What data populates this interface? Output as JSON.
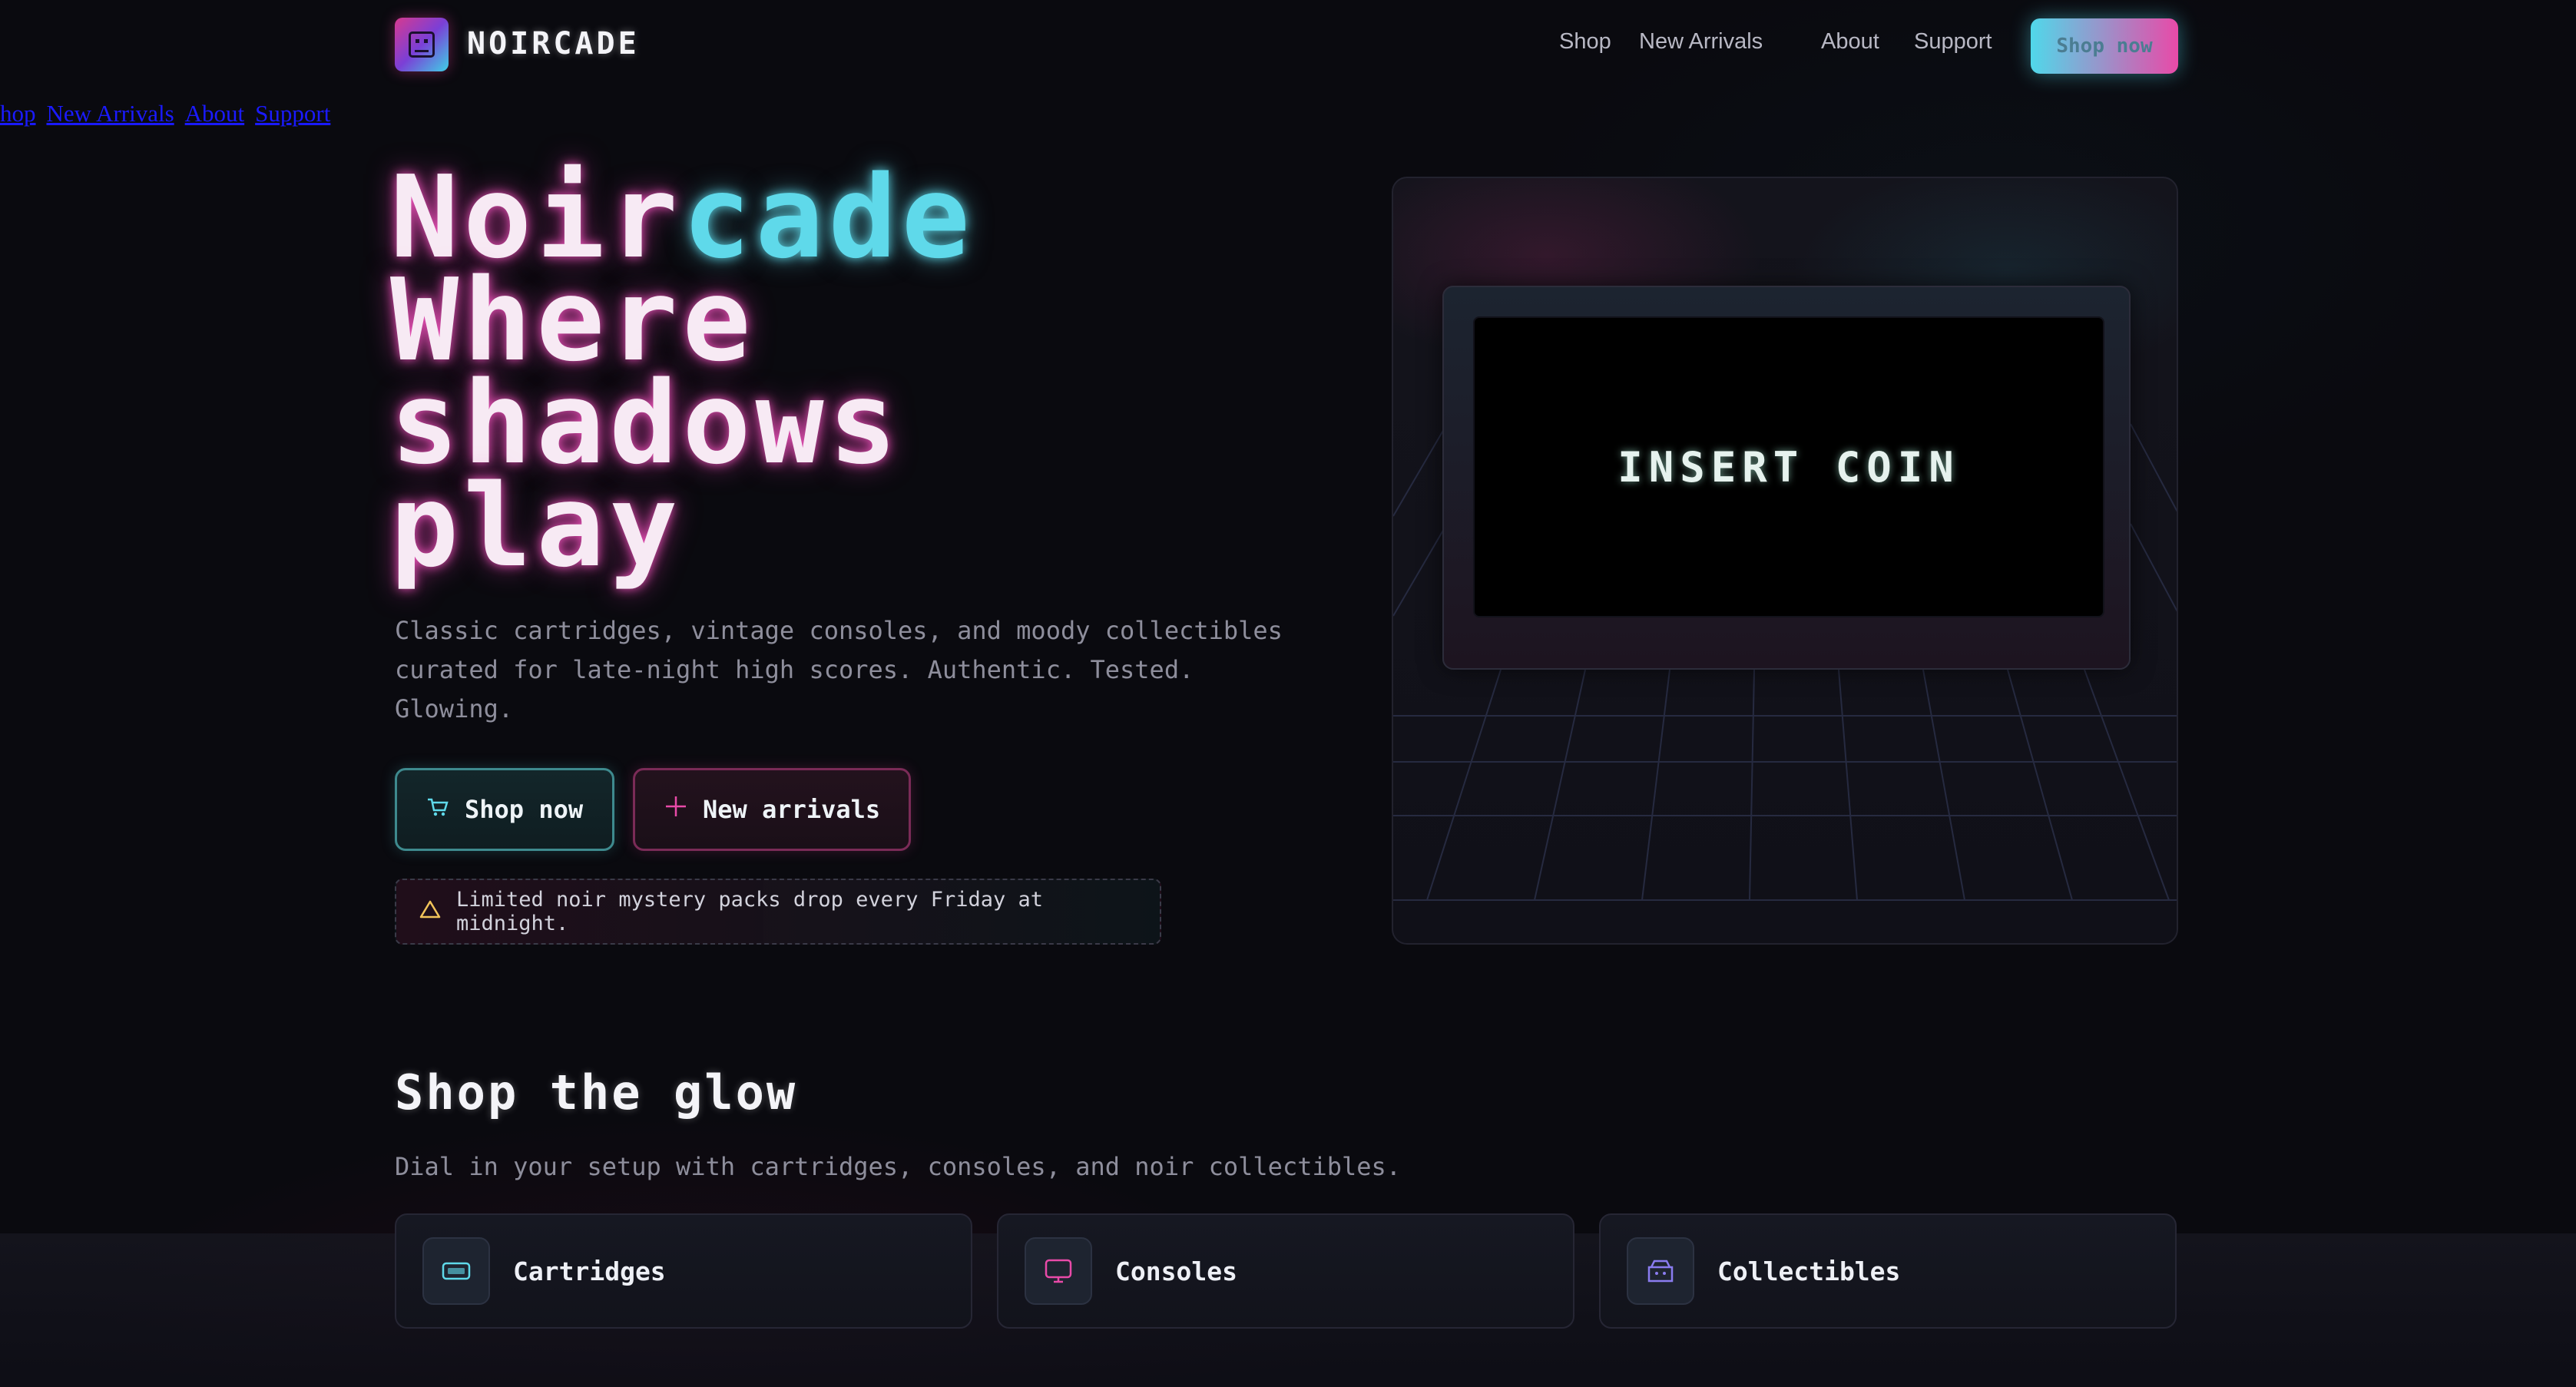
{
  "brand": {
    "name": "NOIRCADE"
  },
  "nav": {
    "links": [
      "Shop",
      "New Arrivals",
      "About",
      "Support"
    ],
    "cta": "Shop now"
  },
  "raw_links": [
    "hop",
    "New Arrivals",
    "About",
    "Support"
  ],
  "hero": {
    "title_part1": "Noir",
    "title_part2": "cade",
    "title_line2": "Where",
    "title_line3": "shadows",
    "title_line4": "play",
    "subtitle": "Classic cartridges, vintage consoles, and moody collectibles curated for late-night high scores. Authentic. Tested. Glowing.",
    "btn_shop": "Shop now",
    "btn_new": "New arrivals",
    "notice": "Limited noir mystery packs drop every Friday at midnight."
  },
  "screen": {
    "text": "INSERT COIN"
  },
  "shop": {
    "title": "Shop the glow",
    "subtitle": "Dial in your setup with cartridges, consoles, and noir collectibles.",
    "categories": [
      {
        "label": "Cartridges",
        "icon": "cartridge-icon",
        "color": "#5fd9ea"
      },
      {
        "label": "Consoles",
        "icon": "monitor-icon",
        "color": "#e84aa8"
      },
      {
        "label": "Collectibles",
        "icon": "box-icon",
        "color": "#8a7cf0"
      }
    ]
  },
  "colors": {
    "cyan": "#5fd9ea",
    "magenta": "#e84aa8",
    "background": "#0a0a0f"
  }
}
